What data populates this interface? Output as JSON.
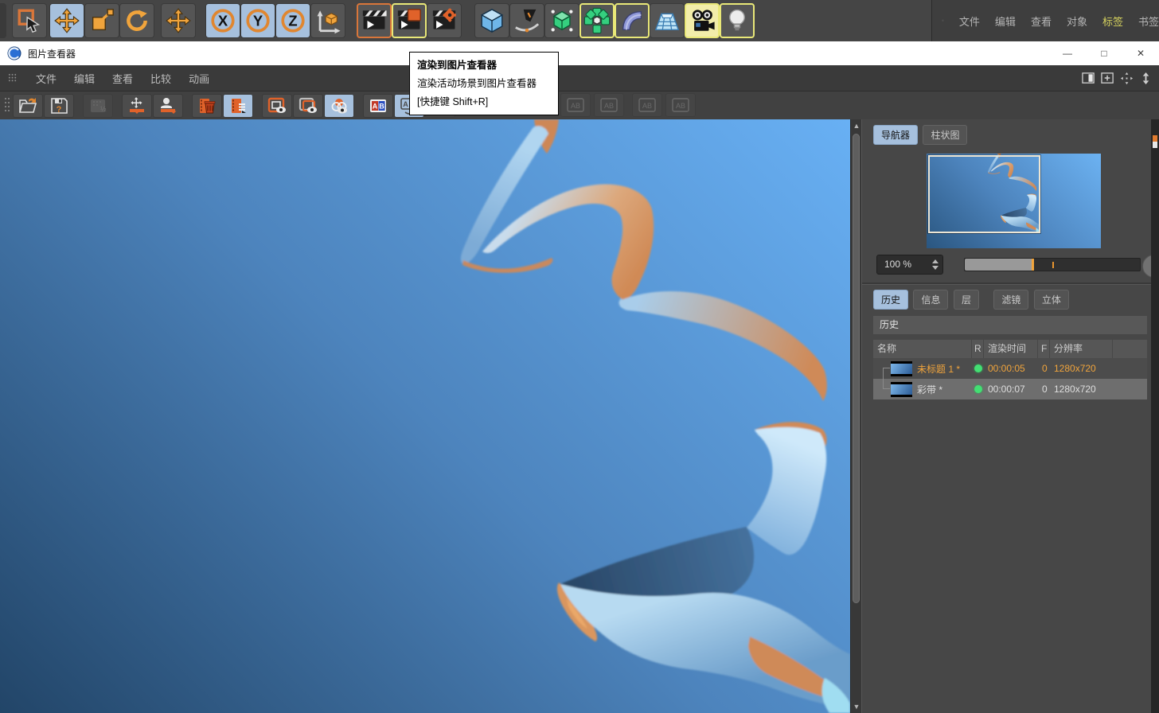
{
  "window": {
    "title": "图片查看器",
    "controls": {
      "minimize": "—",
      "maximize": "□",
      "close": "✕"
    }
  },
  "main_toolbar": {
    "icons": [
      "undo-partial",
      "live-selection",
      "move-tool",
      "scale-tool",
      "rotate-tool",
      "last-tool-move",
      "lock-x-axis",
      "lock-y-axis",
      "lock-z-axis",
      "coordinate-system",
      "render-view",
      "render-to-picture-viewer",
      "render-settings",
      "add-cube",
      "spline-pen",
      "subdivision-surface",
      "cloner",
      "deformer",
      "floor",
      "camera",
      "light"
    ],
    "axis": {
      "x": "X",
      "y": "Y",
      "z": "Z"
    }
  },
  "object_manager_menu": {
    "items": [
      "文件",
      "编辑",
      "查看",
      "对象",
      "标签",
      "书签"
    ],
    "highlighted_item": "标签"
  },
  "viewer_menu": {
    "items": [
      "文件",
      "编辑",
      "查看",
      "比较",
      "动画"
    ]
  },
  "viewer_toolbar": {
    "icons": [
      "panel-grip",
      "open-file",
      "save-image",
      "halftone-disabled",
      "fit-to-screen",
      "actual-size",
      "delete-image",
      "image-list",
      "single-view",
      "dual-view",
      "channels-view",
      "ab-compare",
      "ab-swap"
    ]
  },
  "tooltip": {
    "title": "渲染到图片查看器",
    "description": "渲染活动场景到图片查看器",
    "shortcut": "[快捷键 Shift+R]"
  },
  "navigator": {
    "tabs": [
      "导航器",
      "柱状图"
    ],
    "active_tab": "导航器",
    "zoom_value": "100 %"
  },
  "history": {
    "tabs": [
      "历史",
      "信息",
      "层",
      "滤镜",
      "立体"
    ],
    "active_tab": "历史",
    "section_title": "历史",
    "columns": {
      "name": "名称",
      "r": "R",
      "time": "渲染时间",
      "f": "F",
      "resolution": "分辨率"
    },
    "rows": [
      {
        "name": "未标题 1 *",
        "time": "00:00:05",
        "f": "0",
        "resolution": "1280x720",
        "state": "active"
      },
      {
        "name": "彩带 *",
        "time": "00:00:07",
        "f": "0",
        "resolution": "1280x720",
        "state": "selected"
      }
    ]
  },
  "colors": {
    "highlight_blue": "#a6c0dd",
    "hover_yellow": "#e9e878",
    "active_text_orange": "#f0a43c",
    "status_green": "#43df73",
    "canvas_light": "#68b0f4",
    "canvas_dark": "#224568"
  }
}
